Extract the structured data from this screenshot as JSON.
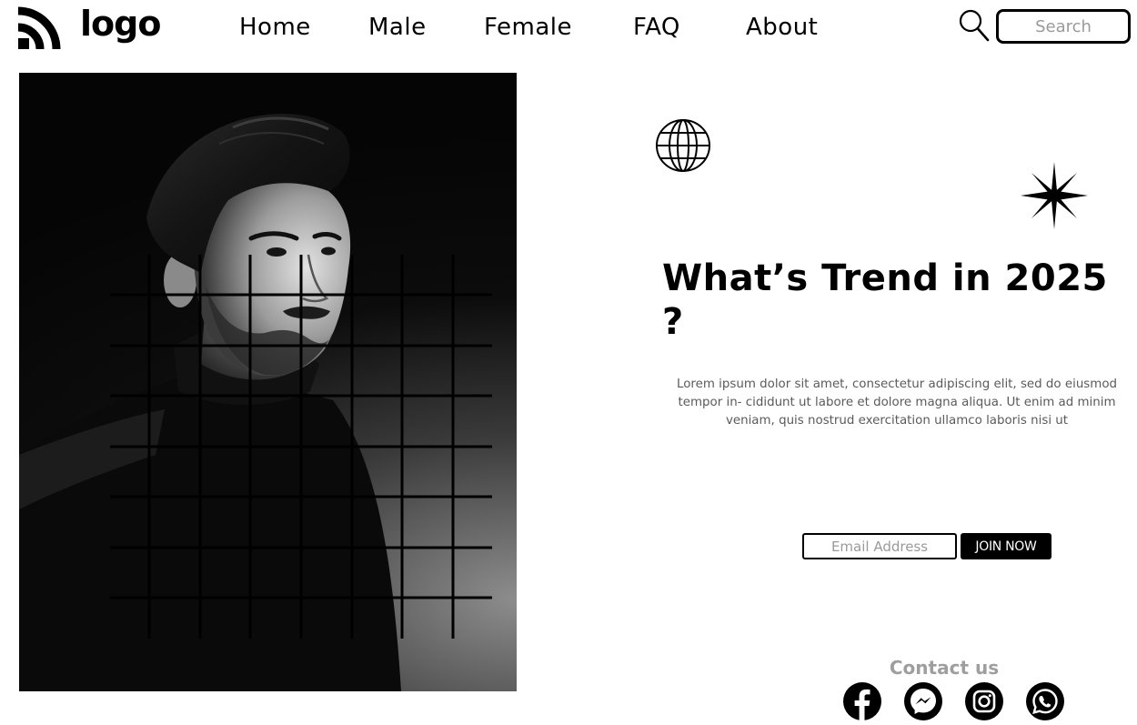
{
  "header": {
    "logo_text": "logo",
    "logo_icon": "wifi-arcs-icon",
    "nav": [
      {
        "label": "Home"
      },
      {
        "label": "Male"
      },
      {
        "label": "Female"
      },
      {
        "label": "FAQ"
      },
      {
        "label": "About"
      }
    ],
    "search": {
      "icon": "search-icon",
      "placeholder": "Search",
      "value": ""
    }
  },
  "hero": {
    "image": "portrait-photo",
    "overlay": "grid-lines"
  },
  "content": {
    "headline": "What’s Trend in 2025 ?",
    "body": "Lorem ipsum dolor sit amet, consectetur adipiscing elit, sed do eiusmod tempor in- cididunt ut labore et dolore magna aliqua. Ut enim ad minim veniam, quis nostrud exercitation ullamco laboris nisi ut",
    "decor_icons": [
      "globe-icon",
      "sparkle-icon"
    ]
  },
  "signup": {
    "email_placeholder": "Email Address",
    "email_value": "",
    "join_label": "JOIN NOW"
  },
  "contact": {
    "title": "Contact us",
    "socials": [
      "facebook-icon",
      "messenger-icon",
      "instagram-icon",
      "whatsapp-icon"
    ]
  },
  "colors": {
    "primary": "#000000",
    "background": "#ffffff",
    "muted_text": "#5a5a5a",
    "contact_title": "#9e9e9e",
    "placeholder": "#9a9a9a"
  }
}
